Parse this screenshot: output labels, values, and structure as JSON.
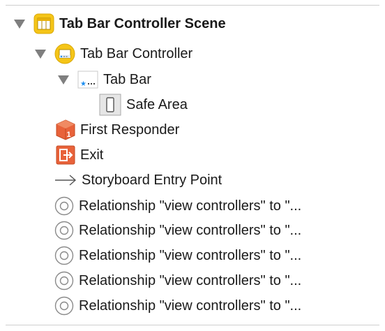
{
  "outline": {
    "scene": {
      "title": "Tab Bar Controller Scene",
      "icon": "scene-icon"
    },
    "tab_bar_controller": {
      "label": "Tab Bar Controller",
      "icon": "tab-bar-controller-icon"
    },
    "tab_bar": {
      "label": "Tab Bar",
      "icon": "tab-bar-icon"
    },
    "safe_area": {
      "label": "Safe Area",
      "icon": "safe-area-icon"
    },
    "first_responder": {
      "label": "First Responder",
      "icon": "first-responder-icon"
    },
    "exit": {
      "label": "Exit",
      "icon": "exit-icon"
    },
    "entry_point": {
      "label": "Storyboard Entry Point",
      "icon": "arrow-right-icon"
    },
    "relationships": [
      {
        "label": "Relationship \"view controllers\" to \"...",
        "icon": "relationship-icon"
      },
      {
        "label": "Relationship \"view controllers\" to \"...",
        "icon": "relationship-icon"
      },
      {
        "label": "Relationship \"view controllers\" to \"...",
        "icon": "relationship-icon"
      },
      {
        "label": "Relationship \"view controllers\" to \"...",
        "icon": "relationship-icon"
      },
      {
        "label": "Relationship \"view controllers\" to \"...",
        "icon": "relationship-icon"
      }
    ]
  },
  "colors": {
    "scene_icon_yellow": "#f5c518",
    "responder_orange": "#e8623a",
    "exit_orange": "#e8623a",
    "tab_blue": "#1c8ef0",
    "disclosure_gray": "#7f7f7f"
  }
}
